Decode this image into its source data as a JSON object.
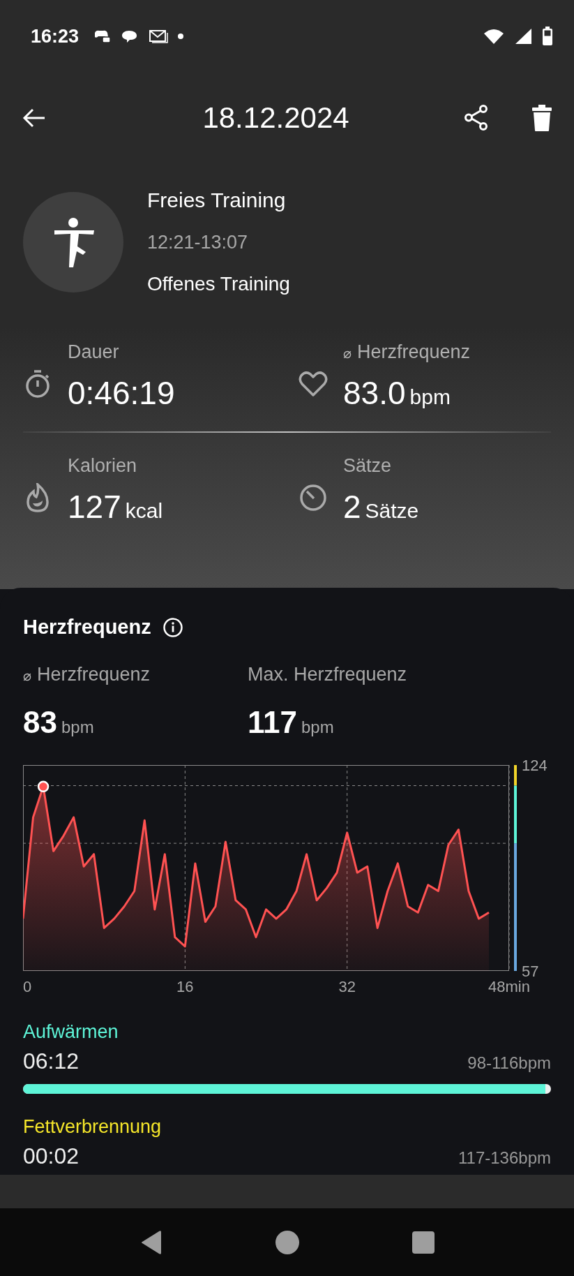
{
  "status_bar": {
    "time": "16:23"
  },
  "app_bar": {
    "title": "18.12.2024"
  },
  "workout": {
    "name": "Freies Training",
    "time_range": "12:21-13:07",
    "type": "Offenes Training"
  },
  "stats": [
    {
      "kind": "duration",
      "label": "Dauer",
      "value": "0:46:19"
    },
    {
      "kind": "heart",
      "prefix": "⌀",
      "label": "Herzfrequenz",
      "value": "83.0",
      "unit": "bpm"
    },
    {
      "kind": "calories",
      "label": "Kalorien",
      "value": "127",
      "unit": "kcal"
    },
    {
      "kind": "sets",
      "label": "Sätze",
      "value": "2",
      "unit": "Sätze"
    }
  ],
  "heart_rate": {
    "title": "Herzfrequenz",
    "summary": [
      {
        "prefix": "⌀",
        "label": "Herzfrequenz",
        "value": "83",
        "unit": "bpm"
      },
      {
        "label": "Max. Herzfrequenz",
        "value": "117",
        "unit": "bpm"
      }
    ],
    "chart_data": {
      "type": "area",
      "x": [
        0,
        1,
        2,
        3,
        4,
        5,
        6,
        7,
        8,
        9,
        10,
        11,
        12,
        13,
        14,
        15,
        16,
        17,
        18,
        19,
        20,
        21,
        22,
        23,
        24,
        25,
        26,
        27,
        28,
        29,
        30,
        31,
        32,
        33,
        34,
        35,
        36,
        37,
        38,
        39,
        40,
        41,
        42,
        43,
        44,
        45,
        46
      ],
      "series": [
        {
          "color": "#ff5252",
          "values": [
            74,
            107,
            117,
            96,
            101,
            107,
            91,
            95,
            71,
            74,
            78,
            83,
            106,
            77,
            95,
            68,
            65,
            92,
            73,
            78,
            99,
            80,
            77,
            68,
            77,
            74,
            77,
            83,
            95,
            80,
            84,
            89,
            102,
            89,
            91,
            71,
            83,
            92,
            78,
            76,
            85,
            83,
            98,
            103,
            83,
            74,
            76
          ]
        }
      ],
      "xlim": [
        0,
        48
      ],
      "ylim": [
        57,
        124
      ],
      "xticks": [
        0,
        16,
        32,
        {
          "value": 48,
          "label": "48min"
        }
      ],
      "yticks": [
        57,
        124
      ]
    },
    "zone_scale": [
      {
        "color": "#f2d52a"
      },
      {
        "color": "#5ef5d8"
      },
      {
        "color": "#6aa8e0"
      }
    ],
    "zones": [
      {
        "name": "Aufwärmen",
        "color": "#5ef5d8",
        "duration": "06:12",
        "range": "98-116bpm",
        "level": 0.99
      },
      {
        "name": "Fettverbrennung",
        "color": "#f5e62a",
        "duration": "00:02",
        "range": "117-136bpm"
      }
    ]
  }
}
